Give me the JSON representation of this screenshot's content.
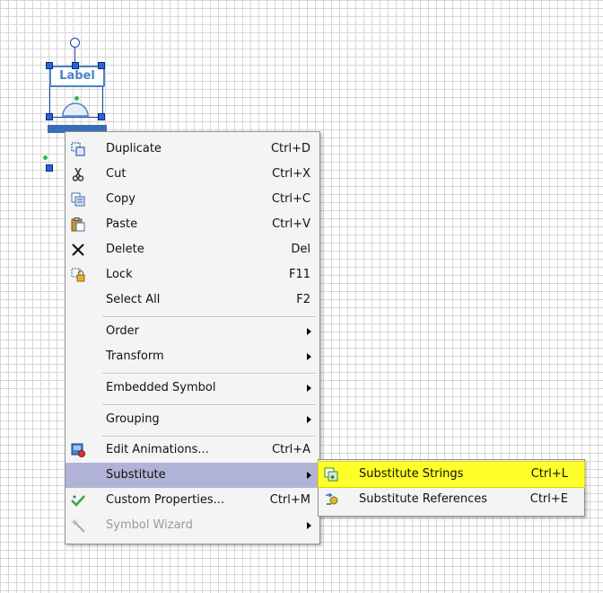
{
  "symbol": {
    "label": "Label"
  },
  "context_menu": {
    "items": [
      {
        "label": "Duplicate",
        "shortcut": "Ctrl+D",
        "icon": "duplicate-icon"
      },
      {
        "label": "Cut",
        "shortcut": "Ctrl+X",
        "icon": "scissors-icon"
      },
      {
        "label": "Copy",
        "shortcut": "Ctrl+C",
        "icon": "copy-icon"
      },
      {
        "label": "Paste",
        "shortcut": "Ctrl+V",
        "icon": "paste-icon"
      },
      {
        "label": "Delete",
        "shortcut": "Del",
        "icon": "x-icon"
      },
      {
        "label": "Lock",
        "shortcut": "F11",
        "icon": "lock-icon"
      },
      {
        "label": "Select All",
        "shortcut": "F2"
      },
      {
        "label": "Order"
      },
      {
        "label": "Transform"
      },
      {
        "label": "Embedded Symbol"
      },
      {
        "label": "Grouping"
      },
      {
        "label": "Edit Animations...",
        "shortcut": "Ctrl+A",
        "icon": "animation-icon"
      },
      {
        "label": "Substitute",
        "highlighted": true
      },
      {
        "label": "Custom Properties...",
        "shortcut": "Ctrl+M",
        "icon": "checkmark-icon"
      },
      {
        "label": "Symbol Wizard",
        "disabled": true,
        "icon": "wand-icon"
      }
    ]
  },
  "substitute_submenu": {
    "items": [
      {
        "label": "Substitute Strings",
        "shortcut": "Ctrl+L",
        "icon": "substitute-strings-icon",
        "highlighted": true
      },
      {
        "label": "Substitute References",
        "shortcut": "Ctrl+E",
        "icon": "substitute-references-icon"
      }
    ]
  },
  "colors": {
    "menu_highlight": "#b1b3d6",
    "submenu_highlight": "#ffff2a",
    "selection": "#2a63d8"
  }
}
